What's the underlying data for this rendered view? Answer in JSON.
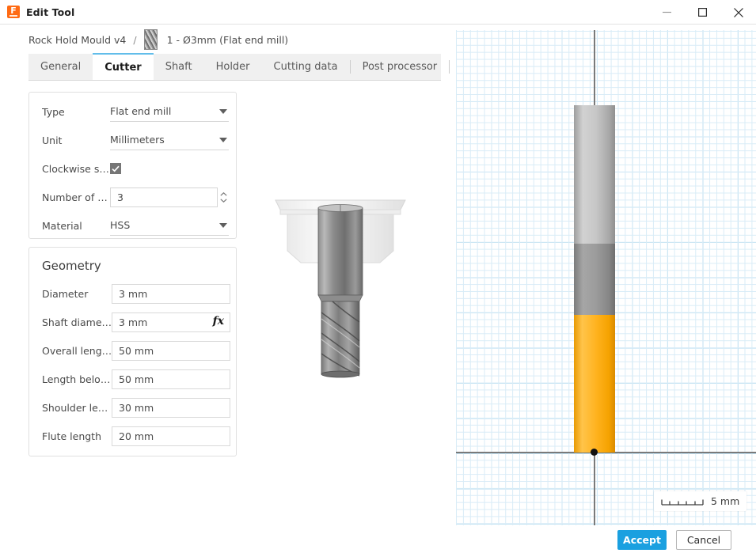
{
  "window": {
    "title": "Edit Tool",
    "app_icon": "fusion-logo-icon",
    "minimize_label": "minimize-icon",
    "maximize_label": "maximize-icon",
    "close_label": "close-icon"
  },
  "breadcrumb": {
    "document": "Rock Hold Mould v4",
    "separator": "/",
    "thumbnail_icon": "endmill-thumbnail-icon",
    "tool": "1 - Ø3mm (Flat end mill)"
  },
  "tabs": [
    {
      "label": "General",
      "active": false
    },
    {
      "label": "Cutter",
      "active": true
    },
    {
      "label": "Shaft",
      "active": false
    },
    {
      "label": "Holder",
      "active": false
    },
    {
      "label": "Cutting data",
      "active": false
    },
    {
      "label": "Post processor",
      "active": false
    }
  ],
  "general_card": {
    "type": {
      "label": "Type",
      "value": "Flat end mill"
    },
    "unit": {
      "label": "Unit",
      "value": "Millimeters"
    },
    "clockwise": {
      "label": "Clockwise s…",
      "checked": true
    },
    "flutes": {
      "label": "Number of …",
      "value": "3"
    },
    "material": {
      "label": "Material",
      "value": "HSS"
    }
  },
  "geometry_card": {
    "title": "Geometry",
    "fields": [
      {
        "label": "Diameter",
        "value": "3 mm",
        "has_fx": false
      },
      {
        "label": "Shaft diame…",
        "value": "3 mm",
        "has_fx": true,
        "fx_label": "fx"
      },
      {
        "label": "Overall leng…",
        "value": "50 mm",
        "has_fx": false
      },
      {
        "label": "Length belo…",
        "value": "50 mm",
        "has_fx": false
      },
      {
        "label": "Shoulder le…",
        "value": "30 mm",
        "has_fx": false
      },
      {
        "label": "Flute length",
        "value": "20 mm",
        "has_fx": false
      }
    ]
  },
  "preview": {
    "tool_3d_icon": "endmill-3d-preview",
    "holder_icon": "tool-holder-preview"
  },
  "graph": {
    "scale_label": "5 mm",
    "scale_icon": "scale-ruler-icon",
    "origin_icon": "origin-point-icon",
    "segments": [
      {
        "name": "shaft",
        "color": "#b8b8b8"
      },
      {
        "name": "shoulder",
        "color": "#8e8e8e"
      },
      {
        "name": "flute",
        "color": "#ffb21e"
      }
    ]
  },
  "footer": {
    "accept_label": "Accept",
    "cancel_label": "Cancel"
  },
  "colors": {
    "accent": "#1aa0e0",
    "active_tab_border": "#62bdea",
    "flute": "#ffb21e",
    "grid_minor": "#d9ecf7",
    "grid_major": "#aed9ef"
  }
}
